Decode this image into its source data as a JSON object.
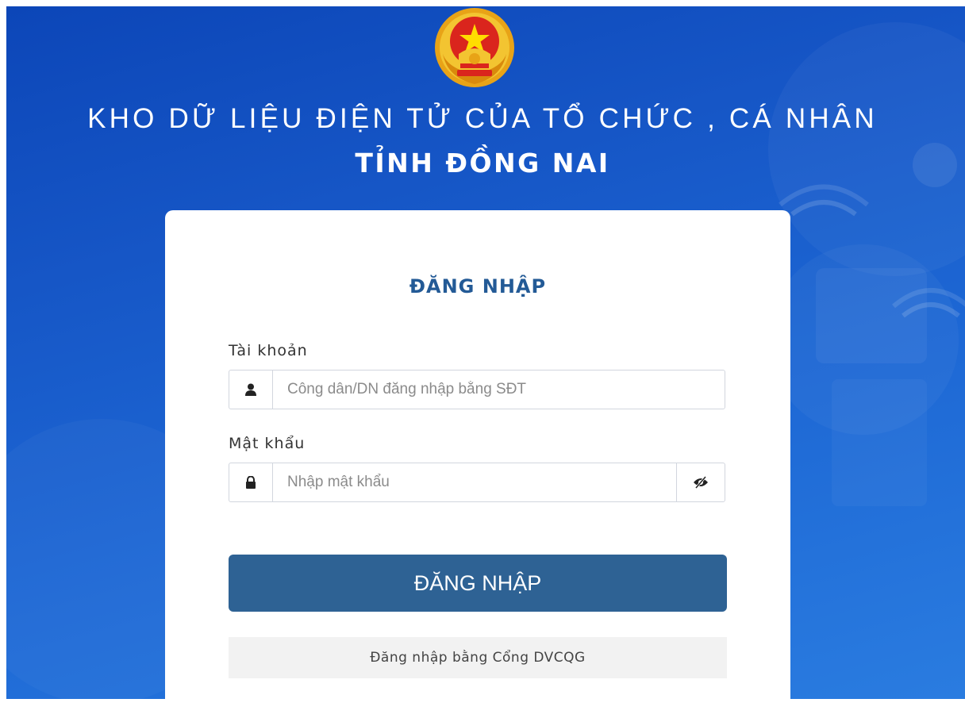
{
  "header": {
    "emblem": "vietnam-national-emblem",
    "title_line1": "KHO DỮ LIỆU ĐIỆN TỬ CỦA TỔ CHỨC , CÁ NHÂN",
    "title_line2": "TỈNH ĐỒNG NAI"
  },
  "login": {
    "heading": "ĐĂNG NHẬP",
    "account_label": "Tài khoản",
    "account_icon": "user-icon",
    "account_placeholder": "Công dân/DN đăng nhập bằng SĐT",
    "account_value": "",
    "password_label": "Mật khẩu",
    "password_icon": "lock-icon",
    "password_placeholder": "Nhập mật khẩu",
    "password_value": "",
    "toggle_icon": "eye-slash-icon",
    "submit_label": "ĐĂNG NHẬP",
    "gov_portal_label": "Đăng nhập bằng Cổng DVCQG"
  },
  "colors": {
    "background": "#1656c6",
    "card": "#ffffff",
    "heading": "#235a96",
    "primary_button": "#2e6294",
    "secondary_button": "#f2f2f2"
  }
}
